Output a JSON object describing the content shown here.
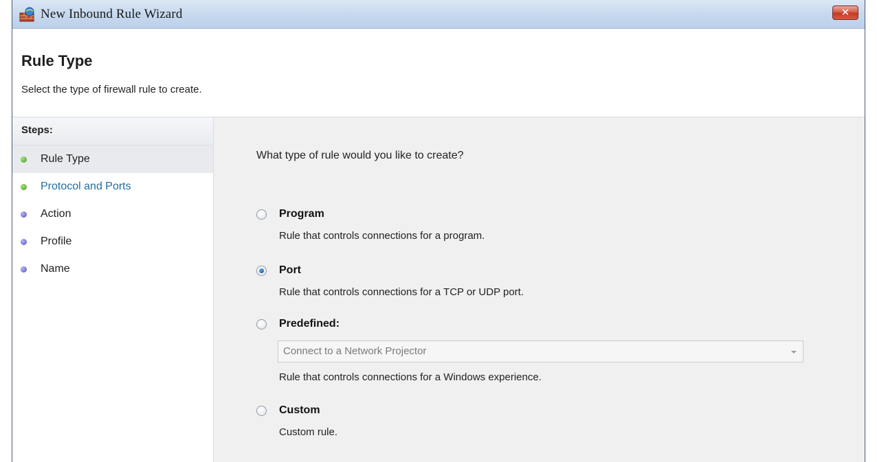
{
  "window": {
    "title": "New Inbound Rule Wizard",
    "close_label": "✕"
  },
  "header": {
    "title": "Rule Type",
    "description": "Select the type of firewall rule to create."
  },
  "steps": {
    "heading": "Steps:",
    "items": [
      {
        "label": "Rule Type",
        "state": "current"
      },
      {
        "label": "Protocol and Ports",
        "state": "link"
      },
      {
        "label": "Action",
        "state": "pending"
      },
      {
        "label": "Profile",
        "state": "pending"
      },
      {
        "label": "Name",
        "state": "pending"
      }
    ]
  },
  "main": {
    "question": "What type of rule would you like to create?",
    "options": [
      {
        "label": "Program",
        "description": "Rule that controls connections for a program.",
        "checked": false
      },
      {
        "label": "Port",
        "description": "Rule that controls connections for a TCP or UDP port.",
        "checked": true
      },
      {
        "label": "Predefined:",
        "description": "Rule that controls connections for a Windows experience.",
        "checked": false
      },
      {
        "label": "Custom",
        "description": "Custom rule.",
        "checked": false
      }
    ],
    "predefined_select": {
      "value": "Connect to a Network Projector"
    }
  },
  "colors": {
    "titlebar": "#c6d8ee",
    "close_button": "#c33a24",
    "link": "#1c6ea0",
    "step_dot_done": "#3f9e1e",
    "step_dot_pending": "#5350c0"
  }
}
